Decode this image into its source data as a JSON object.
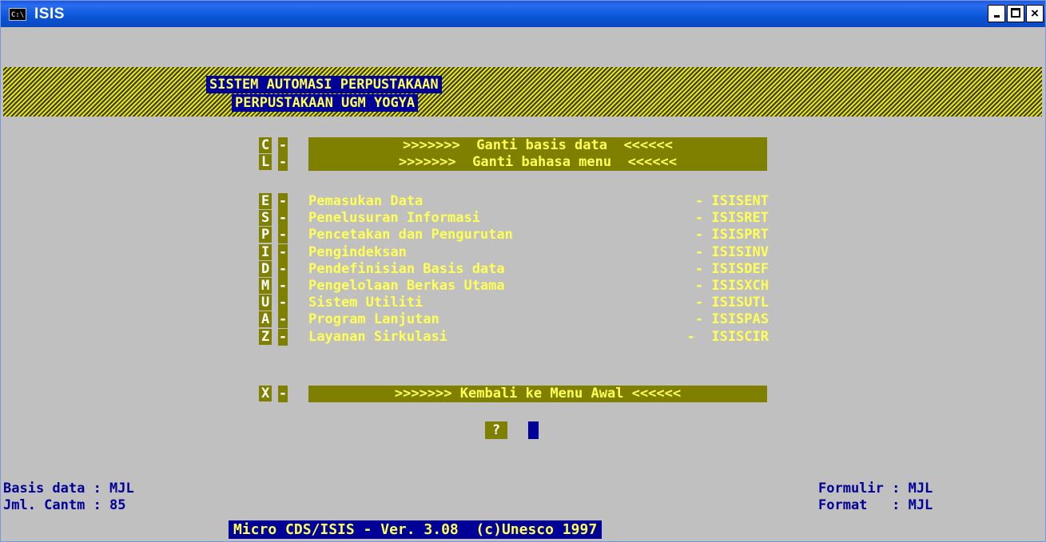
{
  "window": {
    "title": "ISIS",
    "icon_label": "C:\\",
    "minimize_label": "_",
    "maximize_label": "□",
    "close_label": "×"
  },
  "header": {
    "line1": "SISTEM AUTOMASI PERPUSTAKAAN",
    "line2": "PERPUSTAKAAN UGM YOGYA"
  },
  "top_menu": [
    {
      "key": "C",
      "label": ">>>>>>>  Ganti basis data  <<<<<<"
    },
    {
      "key": "L",
      "label": ">>>>>>>  Ganti bahasa menu  <<<<<<"
    }
  ],
  "menu": [
    {
      "key": "E",
      "label": "Pemasukan Data",
      "program": "- ISISENT"
    },
    {
      "key": "S",
      "label": "Penelusuran Informasi",
      "program": "- ISISRET"
    },
    {
      "key": "P",
      "label": "Pencetakan dan Pengurutan",
      "program": "- ISISPRT"
    },
    {
      "key": "I",
      "label": "Pengindeksan",
      "program": "- ISISINV"
    },
    {
      "key": "D",
      "label": "Pendefinisian Basis data",
      "program": "- ISISDEF"
    },
    {
      "key": "M",
      "label": "Pengelolaan Berkas Utama",
      "program": "- ISISXCH"
    },
    {
      "key": "U",
      "label": "Sistem Utiliti",
      "program": "- ISISUTL"
    },
    {
      "key": "A",
      "label": "Program Lanjutan",
      "program": "- ISISPAS"
    },
    {
      "key": "Z",
      "label": "Layanan Sirkulasi",
      "program": "-  ISISCIR"
    }
  ],
  "exit_menu": {
    "key": "X",
    "label": ">>>>>>> Kembali ke Menu Awal <<<<<<"
  },
  "prompt": "?",
  "status_left": {
    "line1": "Basis data : MJL",
    "line2": "Jml. Cantm : 85"
  },
  "status_right": {
    "line1": "Formulir : MJL",
    "line2": "Format   : MJL"
  },
  "footer": "Micro CDS/ISIS - Ver. 3.08  (c)Unesco 1997"
}
